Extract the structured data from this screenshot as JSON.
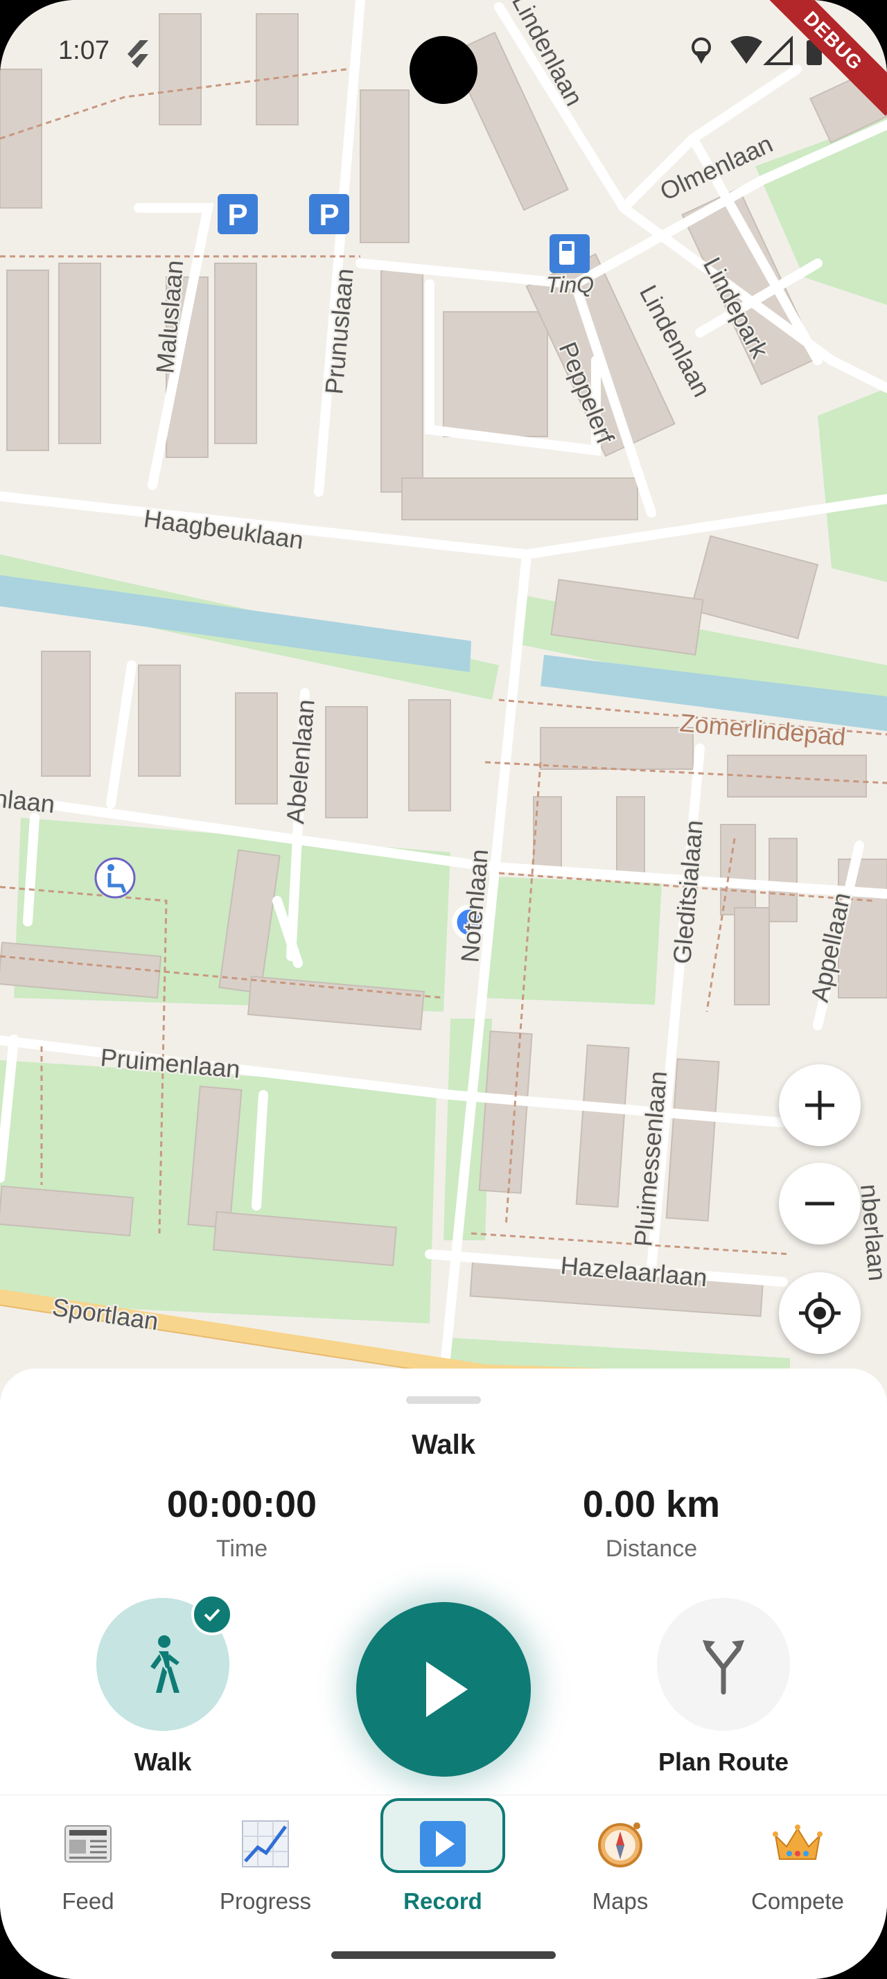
{
  "status_bar": {
    "time": "1:07",
    "debug_banner": "DEBUG"
  },
  "map": {
    "street_labels": [
      "Lindenlaan",
      "Olmenlaan",
      "Lindepark",
      "Lindenlaan",
      "Maluslaan",
      "Prunuslaan",
      "Peppelerf",
      "Haagbeuklaan",
      "Abelenlaan",
      "Zomerlindepad",
      "nlaan",
      "Notenlaan",
      "Gleditsialaan",
      "Appellaan",
      "Pruimenlaan",
      "Pluimessenlaan",
      "Hazelaarlaan",
      "Sportlaan",
      "nberlaan"
    ],
    "poi_labels": {
      "fuel": "TinQ"
    },
    "controls": {
      "zoom_in": "+",
      "zoom_out": "−"
    }
  },
  "sheet": {
    "title": "Walk",
    "time_value": "00:00:00",
    "time_label": "Time",
    "distance_value": "0.00 km",
    "distance_label": "Distance",
    "walk_label": "Walk",
    "plan_route_label": "Plan Route"
  },
  "nav": {
    "items": [
      {
        "label": "Feed",
        "icon": "newspaper-icon"
      },
      {
        "label": "Progress",
        "icon": "chart-icon"
      },
      {
        "label": "Record",
        "icon": "play-icon",
        "active": true
      },
      {
        "label": "Maps",
        "icon": "compass-icon"
      },
      {
        "label": "Compete",
        "icon": "crown-icon"
      }
    ]
  },
  "colors": {
    "accent": "#0f7b75",
    "park": "#cdeac3",
    "water": "#aad3df",
    "building": "#d9d0c9"
  }
}
